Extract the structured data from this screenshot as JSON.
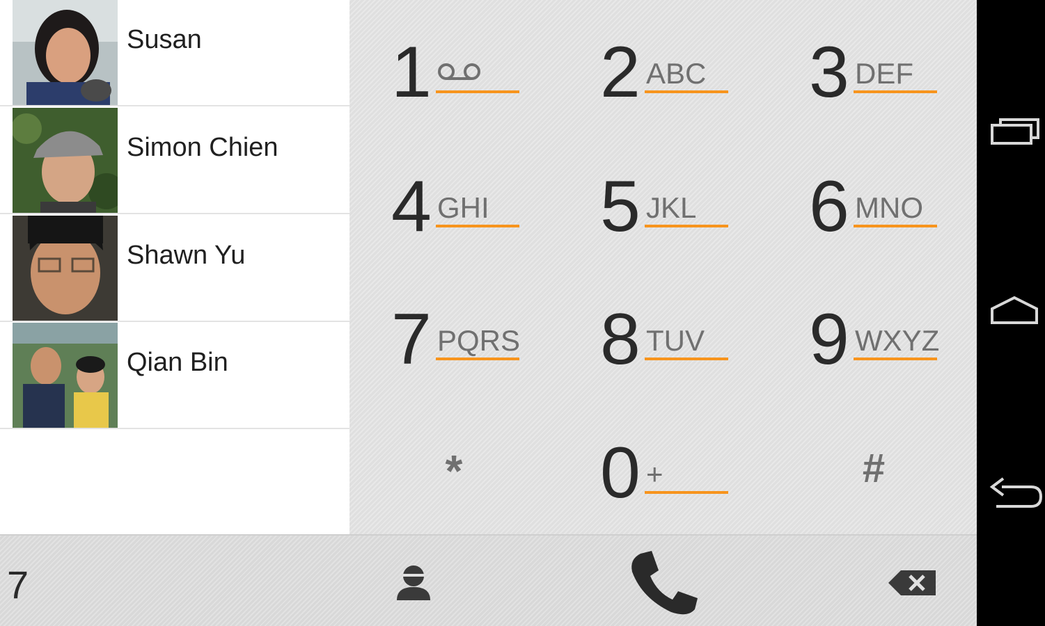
{
  "contacts": [
    {
      "name": "Susan"
    },
    {
      "name": "Simon Chien"
    },
    {
      "name": "Shawn Yu"
    },
    {
      "name": "Qian Bin"
    }
  ],
  "keypad": {
    "keys": [
      {
        "digit": "1",
        "letters": "voicemail-icon"
      },
      {
        "digit": "2",
        "letters": "ABC"
      },
      {
        "digit": "3",
        "letters": "DEF"
      },
      {
        "digit": "4",
        "letters": "GHI"
      },
      {
        "digit": "5",
        "letters": "JKL"
      },
      {
        "digit": "6",
        "letters": "MNO"
      },
      {
        "digit": "7",
        "letters": "PQRS"
      },
      {
        "digit": "8",
        "letters": "TUV"
      },
      {
        "digit": "9",
        "letters": "WXYZ"
      },
      {
        "symbol": "*"
      },
      {
        "digit": "0",
        "letters": "+"
      },
      {
        "symbol": "#"
      }
    ],
    "accent_color": "#f7941d"
  },
  "bottom_bar": {
    "entered_number": "7",
    "icons": [
      "add-contact-icon",
      "phone-call-icon",
      "backspace-icon"
    ]
  },
  "nav_bar": {
    "icons": [
      "recent-apps-icon",
      "home-icon",
      "back-icon"
    ]
  }
}
